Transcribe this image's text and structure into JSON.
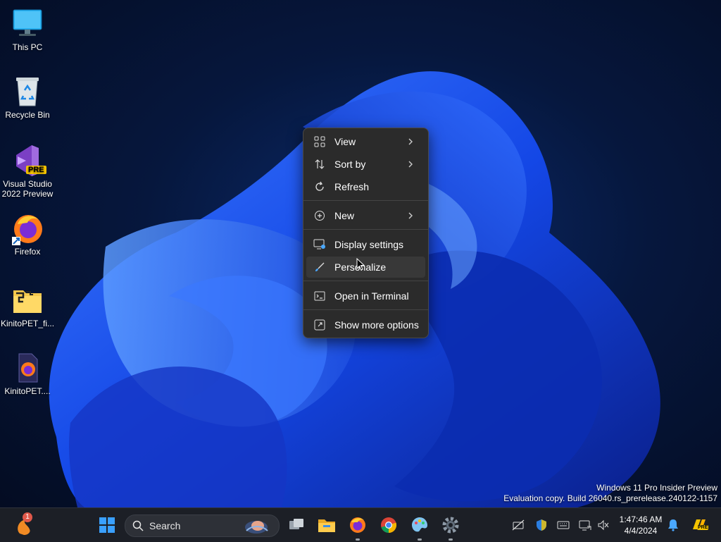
{
  "desktop": {
    "icons": [
      {
        "label": "This PC",
        "icon": "monitor-icon"
      },
      {
        "label": "Recycle Bin",
        "icon": "recycle-bin-icon"
      },
      {
        "label": "Visual Studio 2022 Preview",
        "icon": "visual-studio-icon",
        "badge": "PRE"
      },
      {
        "label": "Firefox",
        "icon": "firefox-icon"
      },
      {
        "label": "KinitoPET_fi...",
        "icon": "folder-icon"
      },
      {
        "label": "KinitoPET....",
        "icon": "firefox-file-icon"
      }
    ]
  },
  "context_menu": {
    "items": [
      {
        "label": "View",
        "icon": "view-grid-icon",
        "submenu": true
      },
      {
        "label": "Sort by",
        "icon": "sort-icon",
        "submenu": true
      },
      {
        "label": "Refresh",
        "icon": "refresh-icon",
        "submenu": false
      },
      {
        "label": "New",
        "icon": "new-plus-icon",
        "submenu": true
      },
      {
        "label": "Display settings",
        "icon": "display-settings-icon",
        "submenu": false
      },
      {
        "label": "Personalize",
        "icon": "brush-icon",
        "submenu": false,
        "hovered": true
      },
      {
        "label": "Open in Terminal",
        "icon": "terminal-icon",
        "submenu": false
      },
      {
        "label": "Show more options",
        "icon": "show-more-icon",
        "submenu": false
      }
    ]
  },
  "watermark": {
    "line1": "Windows 11 Pro Insider Preview",
    "line2": "Evaluation copy. Build 26040.rs_prerelease.240122-1157"
  },
  "taskbar": {
    "widgets_badge": "1",
    "search_placeholder": "Search",
    "apps": [
      "task-view-icon",
      "file-explorer-icon",
      "firefox-icon",
      "chrome-icon",
      "paint-icon",
      "settings-icon"
    ],
    "tray": [
      "network-off-icon",
      "defender-icon",
      "keyboard-icon",
      "display-icon",
      "volume-muted-icon"
    ],
    "clock": {
      "time": "1:47:46 AM",
      "date": "4/4/2024"
    },
    "copilot_badge": "PRE"
  },
  "colors": {
    "accent": "#1a5cff",
    "menu_bg": "#2b2b2b",
    "taskbar_bg": "#1c1f26"
  }
}
